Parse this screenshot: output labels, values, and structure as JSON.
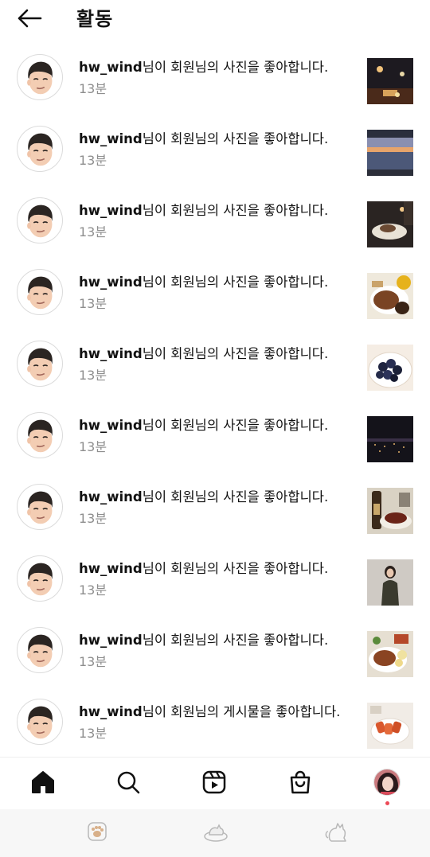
{
  "header": {
    "title": "활동"
  },
  "activity": [
    {
      "username": "hw_wind",
      "message": "님이 회원님의 사진을 좋아합니다.",
      "time": "13분"
    },
    {
      "username": "hw_wind",
      "message": "님이 회원님의 사진을 좋아합니다.",
      "time": "13분"
    },
    {
      "username": "hw_wind",
      "message": "님이 회원님의 사진을 좋아합니다.",
      "time": "13분"
    },
    {
      "username": "hw_wind",
      "message": "님이 회원님의 사진을 좋아합니다.",
      "time": "13분"
    },
    {
      "username": "hw_wind",
      "message": "님이 회원님의 사진을 좋아합니다.",
      "time": "13분"
    },
    {
      "username": "hw_wind",
      "message": "님이 회원님의 사진을 좋아합니다.",
      "time": "13분"
    },
    {
      "username": "hw_wind",
      "message": "님이 회원님의 사진을 좋아합니다.",
      "time": "13분"
    },
    {
      "username": "hw_wind",
      "message": "님이 회원님의 사진을 좋아합니다.",
      "time": "13분"
    },
    {
      "username": "hw_wind",
      "message": "님이 회원님의 사진을 좋아합니다.",
      "time": "13분"
    },
    {
      "username": "hw_wind",
      "message": "님이 회원님의 게시물을 좋아합니다.",
      "time": "13분"
    }
  ],
  "nav": {
    "items": [
      "home-icon",
      "search-icon",
      "reels-icon",
      "shop-icon",
      "profile-avatar"
    ],
    "notification_color": "#ed4956"
  },
  "system_bar": {
    "items": [
      "paw-icon",
      "cat-bowl-icon",
      "cat-icon"
    ]
  }
}
